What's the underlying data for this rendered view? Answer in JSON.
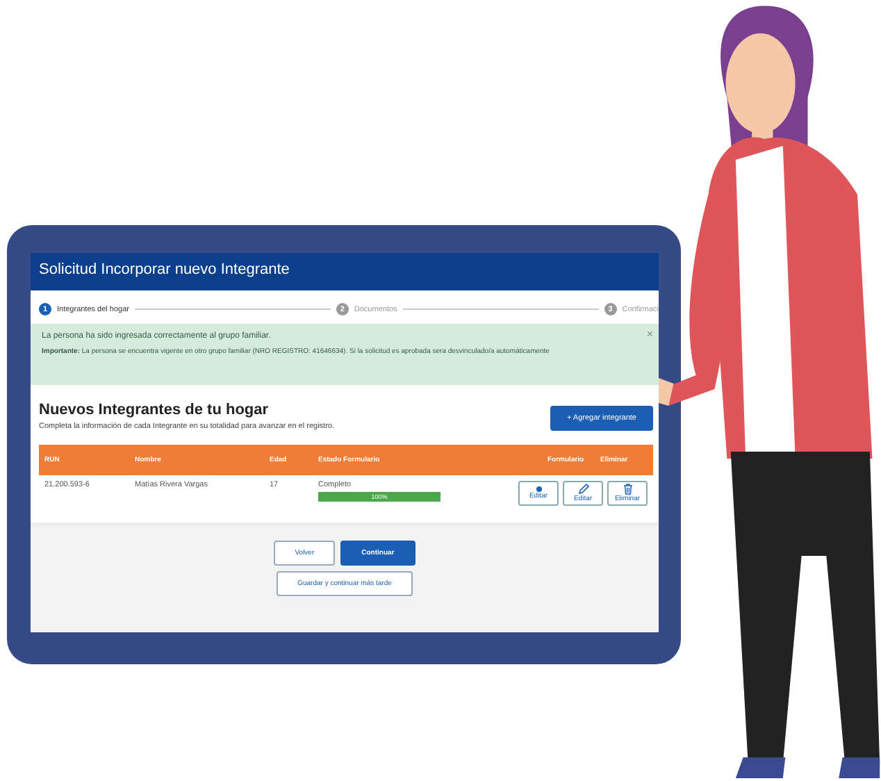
{
  "window": {
    "title": "Solicitud Incorporar nuevo Integrante"
  },
  "steps": [
    {
      "number": "1",
      "label": "Integrantes del hogar",
      "selected": true
    },
    {
      "number": "2",
      "label": "Documentos",
      "selected": false
    },
    {
      "number": "3",
      "label": "Confirmaci",
      "selected": false
    }
  ],
  "alert": {
    "message": "La persona ha sido ingresada correctamente al grupo familiar.",
    "detail": "**Importante:** La persona se encuentra vigente en otro grupo familiar (NRO REGISTRO: 41646634). Si la solicitud es aprobada sera desvinculado/a automáticamente",
    "close": "×"
  },
  "section": {
    "title": "Nuevos Integrantes de tu hogar",
    "subtitle": "Completa la información de cada Integrante en su totalidad para avanzar en el registro.",
    "add_button": "+ Agregar integrante"
  },
  "table": {
    "columns": [
      "RUN",
      "Nombre",
      "Edad",
      "Estado Formulario",
      "Formulario",
      "Eliminar"
    ],
    "rows": [
      {
        "run": "21.200.593-6",
        "nombre": "Matías Rivera Vargas",
        "edad": "17",
        "estado": "Completo",
        "level": 1,
        "progress_text": "100%",
        "actions": [
          {
            "kind": "dot",
            "label": "Editar"
          },
          {
            "kind": "pencil",
            "label": "Editar"
          },
          {
            "kind": "trash",
            "label": "Eliminar"
          }
        ]
      }
    ]
  },
  "footer": {
    "back": "Volver",
    "continue": "Continuar",
    "save": "Guardar y continuar más tarde"
  }
}
